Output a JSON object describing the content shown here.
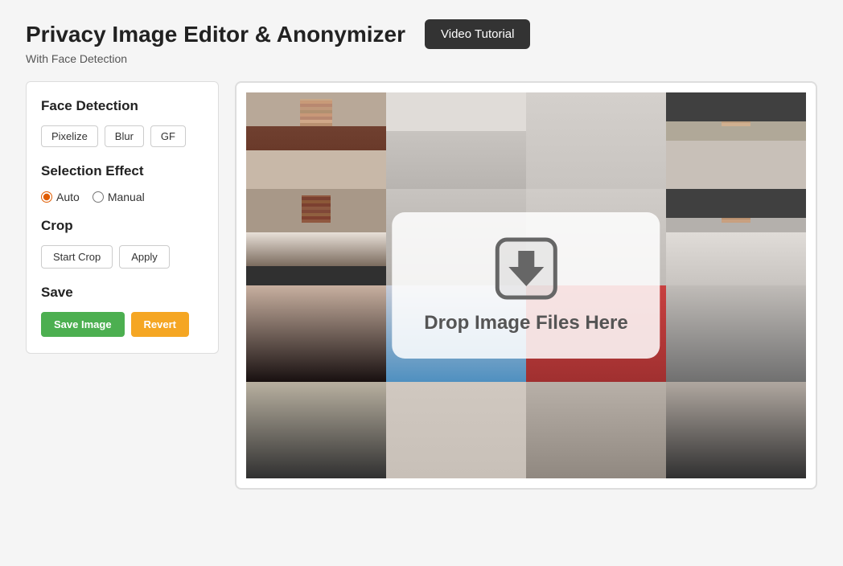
{
  "page": {
    "title": "Privacy Image Editor &  Anonymizer",
    "subtitle": "With Face Detection",
    "video_tutorial_label": "Video Tutorial"
  },
  "sidebar": {
    "face_detection": {
      "section_title": "Face Detection",
      "buttons": [
        {
          "label": "Pixelize",
          "id": "btn-pixelize"
        },
        {
          "label": "Blur",
          "id": "btn-blur"
        },
        {
          "label": "GF",
          "id": "btn-gf"
        }
      ]
    },
    "selection_effect": {
      "section_title": "Selection Effect",
      "options": [
        {
          "label": "Auto",
          "value": "auto",
          "checked": true
        },
        {
          "label": "Manual",
          "value": "manual",
          "checked": false
        }
      ]
    },
    "crop": {
      "section_title": "Crop",
      "start_crop_label": "Start Crop",
      "apply_label": "Apply"
    },
    "save": {
      "section_title": "Save",
      "save_image_label": "Save Image",
      "revert_label": "Revert"
    }
  },
  "drop_zone": {
    "drop_text": "Drop Image Files Here"
  }
}
